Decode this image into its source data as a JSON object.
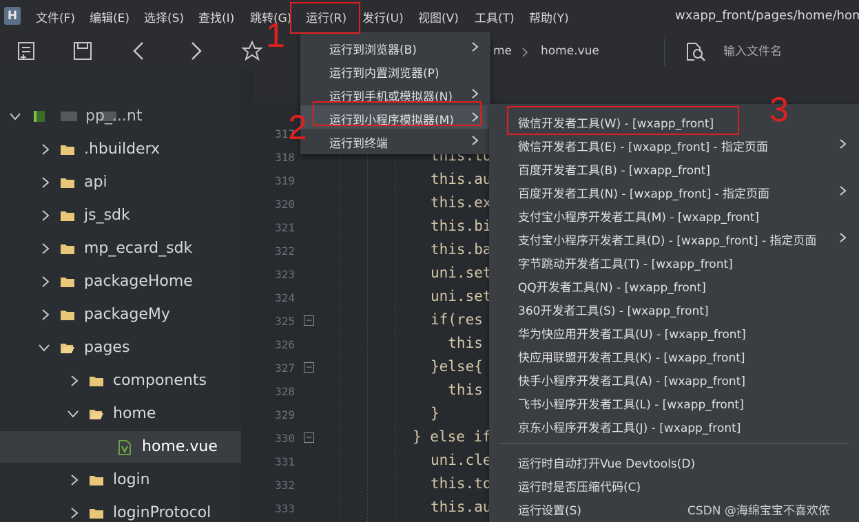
{
  "menubar": {
    "logo": "H",
    "items": [
      {
        "label": "文件(F)"
      },
      {
        "label": "编辑(E)"
      },
      {
        "label": "选择(S)"
      },
      {
        "label": "查找(I)"
      },
      {
        "label": "跳转(G)"
      },
      {
        "label": "运行(R)"
      },
      {
        "label": "发行(U)"
      },
      {
        "label": "视图(V)"
      },
      {
        "label": "工具(T)"
      },
      {
        "label": "帮助(Y)"
      }
    ],
    "path_title": "wxapp_front/pages/home/hom"
  },
  "toolbar": {
    "icons": [
      "new-file-icon",
      "save-icon",
      "back-icon",
      "forward-icon",
      "star-icon"
    ],
    "breadcrumb": [
      "me",
      "home.vue"
    ],
    "file_search": {
      "placeholder": "输入文件名"
    }
  },
  "sidebar": {
    "items": [
      {
        "label": "pp_...nt",
        "expanded": true,
        "type": "project"
      },
      {
        "label": ".hbuilderx",
        "expanded": false,
        "type": "folder"
      },
      {
        "label": "api",
        "expanded": false,
        "type": "folder"
      },
      {
        "label": "js_sdk",
        "expanded": false,
        "type": "folder"
      },
      {
        "label": "mp_ecard_sdk",
        "expanded": false,
        "type": "folder"
      },
      {
        "label": "packageHome",
        "expanded": false,
        "type": "folder"
      },
      {
        "label": "packageMy",
        "expanded": false,
        "type": "folder"
      },
      {
        "label": "pages",
        "expanded": true,
        "type": "folder"
      },
      {
        "label": "components",
        "expanded": false,
        "type": "folder"
      },
      {
        "label": "home",
        "expanded": true,
        "type": "folder"
      },
      {
        "label": "home.vue",
        "type": "file",
        "selected": true
      },
      {
        "label": "login",
        "expanded": false,
        "type": "folder"
      },
      {
        "label": "loginProtocol",
        "expanded": false,
        "type": "folder"
      }
    ]
  },
  "editor": {
    "lines": [
      {
        "num": "317",
        "code": ""
      },
      {
        "num": "318",
        "code": "this.to"
      },
      {
        "num": "319",
        "code": "this.au"
      },
      {
        "num": "320",
        "code": "this.ex"
      },
      {
        "num": "321",
        "code": "this.bi"
      },
      {
        "num": "322",
        "code": "this.ba"
      },
      {
        "num": "323",
        "code": "uni.set"
      },
      {
        "num": "324",
        "code": "uni.set"
      },
      {
        "num": "325",
        "code": "if(res"
      },
      {
        "num": "326",
        "code": "  this"
      },
      {
        "num": "327",
        "code": "}else{"
      },
      {
        "num": "328",
        "code": "  this"
      },
      {
        "num": "329",
        "code": "}"
      },
      {
        "num": "330",
        "code": "} else if"
      },
      {
        "num": "331",
        "code": "uni.cle"
      },
      {
        "num": "332",
        "code": "this.to"
      },
      {
        "num": "333",
        "code": "this.au"
      }
    ]
  },
  "run_menu": {
    "items": [
      {
        "label": "运行到浏览器(B)",
        "submenu": true
      },
      {
        "label": "运行到内置浏览器(P)",
        "submenu": false
      },
      {
        "label": "运行到手机或模拟器(N)",
        "submenu": true
      },
      {
        "label": "运行到小程序模拟器(M)",
        "submenu": true,
        "hover": true
      },
      {
        "label": "运行到终端",
        "submenu": true
      }
    ]
  },
  "sub_menu": {
    "items": [
      {
        "label": "微信开发者工具(W) - [wxapp_front]",
        "submenu": false
      },
      {
        "label": "微信开发者工具(E) - [wxapp_front] - 指定页面",
        "submenu": true
      },
      {
        "label": "百度开发者工具(B) - [wxapp_front]",
        "submenu": false
      },
      {
        "label": "百度开发者工具(N) - [wxapp_front] - 指定页面",
        "submenu": true
      },
      {
        "label": "支付宝小程序开发者工具(M) - [wxapp_front]",
        "submenu": false
      },
      {
        "label": "支付宝小程序开发者工具(D) - [wxapp_front] - 指定页面",
        "submenu": true
      },
      {
        "label": "字节跳动开发者工具(T) - [wxapp_front]",
        "submenu": false
      },
      {
        "label": "QQ开发者工具(N) - [wxapp_front]",
        "submenu": false
      },
      {
        "label": "360开发者工具(S) - [wxapp_front]",
        "submenu": false
      },
      {
        "label": "华为快应用开发者工具(U) - [wxapp_front]",
        "submenu": false
      },
      {
        "label": "快应用联盟开发者工具(K) - [wxapp_front]",
        "submenu": false
      },
      {
        "label": "快手小程序开发者工具(A) - [wxapp_front]",
        "submenu": false
      },
      {
        "label": "飞书小程序开发者工具(L) - [wxapp_front]",
        "submenu": false
      },
      {
        "label": "京东小程序开发者工具(J) - [wxapp_front]",
        "submenu": false
      }
    ],
    "extra_items": [
      {
        "label": "运行时自动打开Vue Devtools(D)"
      },
      {
        "label": "运行时是否压缩代码(C)"
      },
      {
        "label": "运行设置(S)"
      }
    ]
  },
  "annotations": {
    "step1": "1",
    "step2": "2",
    "step3": "3"
  },
  "watermark": "CSDN @海绵宝宝不喜欢侬",
  "colors": {
    "annotation": "#e02020",
    "background": "#272a2e",
    "menu_bg": "#3a3d42"
  }
}
